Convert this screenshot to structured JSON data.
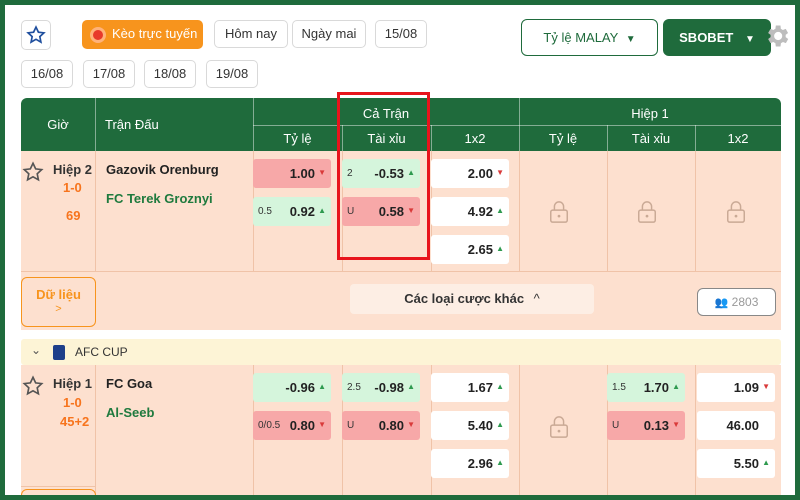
{
  "top_bar": {
    "live_label": "Kèo trực tuyến",
    "dates": [
      "Hôm nay",
      "Ngày mai",
      "15/08",
      "16/08",
      "17/08",
      "18/08",
      "19/08"
    ],
    "odds_type_label": "Tỷ lệ MALAY",
    "bookmaker_label": "SBOBET",
    "colors": {
      "brand": "#1f6b3c",
      "accent": "#f7941d"
    }
  },
  "table": {
    "col_time": "Giờ",
    "col_match": "Trận Đấu",
    "group_full": "Cả Trận",
    "group_half": "Hiệp 1",
    "sub_handicap": "Tỷ lệ",
    "sub_over_under": "Tài xỉu",
    "sub_1x2": "1x2"
  },
  "match1": {
    "status": "Hiệp 2",
    "score": "1-0",
    "minute": "69",
    "home": "Gazovik Orenburg",
    "away": "FC Terek Groznyi",
    "full_handicap": [
      {
        "line": "",
        "value": "1.00",
        "dir": "down"
      },
      {
        "line": "0.5",
        "value": "0.92",
        "dir": "up"
      }
    ],
    "full_over_under": [
      {
        "line": "2",
        "value": "-0.53",
        "dir": "up"
      },
      {
        "line": "U",
        "value": "0.58",
        "dir": "down"
      }
    ],
    "full_1x2": [
      {
        "value": "2.00",
        "dir": "down"
      },
      {
        "value": "4.92",
        "dir": "up"
      },
      {
        "value": "2.65",
        "dir": "up"
      }
    ],
    "data_label": "Dữ liệu",
    "more_bets_label": "Các loại cược khác",
    "viewers": "2803"
  },
  "league": {
    "name": "AFC CUP"
  },
  "match2": {
    "status": "Hiệp 1",
    "score": "1-0",
    "minute": "45+2",
    "home": "FC Goa",
    "away": "Al-Seeb",
    "full_handicap": [
      {
        "line": "",
        "value": "-0.96",
        "dir": "up"
      },
      {
        "line": "0/0.5",
        "value": "0.80",
        "dir": "down"
      }
    ],
    "full_over_under": [
      {
        "line": "2.5",
        "value": "-0.98",
        "dir": "up"
      },
      {
        "line": "U",
        "value": "0.80",
        "dir": "down"
      }
    ],
    "full_1x2": [
      {
        "value": "1.67",
        "dir": "up"
      },
      {
        "value": "5.40",
        "dir": "up"
      },
      {
        "value": "2.96",
        "dir": "up"
      }
    ],
    "half_over_under": [
      {
        "line": "1.5",
        "value": "1.70",
        "dir": "up"
      },
      {
        "line": "U",
        "value": "0.13",
        "dir": "down"
      }
    ],
    "half_1x2": [
      {
        "value": "1.09",
        "dir": "down"
      },
      {
        "value": "46.00",
        "dir": ""
      },
      {
        "value": "5.50",
        "dir": "up"
      }
    ]
  }
}
